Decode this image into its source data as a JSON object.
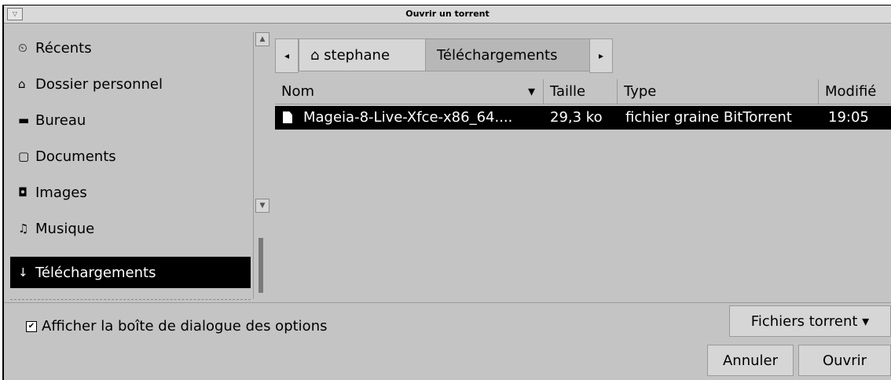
{
  "window": {
    "title": "Ouvrir un torrent",
    "menu_glyph": "▽"
  },
  "sidebar": {
    "items": [
      {
        "icon": "clock-icon",
        "glyph": "⏲",
        "label": "Récents"
      },
      {
        "icon": "home-icon",
        "glyph": "⌂",
        "label": "Dossier personnel"
      },
      {
        "icon": "folder-icon",
        "glyph": "▬",
        "label": "Bureau"
      },
      {
        "icon": "document-icon",
        "glyph": "▢",
        "label": "Documents"
      },
      {
        "icon": "camera-icon",
        "glyph": "◘",
        "label": "Images"
      },
      {
        "icon": "music-icon",
        "glyph": "♫",
        "label": "Musique"
      },
      {
        "icon": "download-icon",
        "glyph": "↓",
        "label": "Téléchargements",
        "active": true
      }
    ]
  },
  "pathbar": {
    "back_glyph": "◂",
    "forward_glyph": "▸",
    "segments": [
      {
        "glyph": "⌂",
        "label": "stephane"
      },
      {
        "label": "Téléchargements",
        "active": true
      }
    ]
  },
  "filelist": {
    "columns": {
      "name": "Nom",
      "sort_glyph": "▾",
      "size": "Taille",
      "type": "Type",
      "modified": "Modifié"
    },
    "rows": [
      {
        "name": "Mageia-8-Live-Xfce-x86_64....",
        "size": "29,3 ko",
        "type": "fichier graine BitTorrent",
        "modified": "19:05",
        "selected": true
      }
    ]
  },
  "footer": {
    "show_options_label": "Afficher la boîte de dialogue des options",
    "show_options_checked": true,
    "filter_label": "Fichiers torrent",
    "filter_glyph": "▾",
    "cancel_label": "Annuler",
    "open_label": "Ouvrir"
  }
}
